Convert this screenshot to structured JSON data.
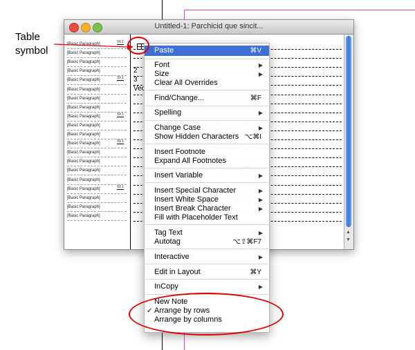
{
  "annotation": {
    "callout_line1": "Table",
    "callout_line2": "symbol",
    "highlight_color": "#e00000"
  },
  "window": {
    "title": "Untitled-1: Parchicid que sincit..."
  },
  "story_editor": {
    "style_rows": [
      {
        "label": "[Basic Paragraph]",
        "num": "59.1"
      },
      {
        "label": "[Basic Paragraph]",
        "num": ""
      },
      {
        "label": "[Basic Paragraph]",
        "num": ""
      },
      {
        "label": "[Basic Paragraph]",
        "num": ""
      },
      {
        "label": "[Basic Paragraph]",
        "num": "59.1"
      },
      {
        "label": "[Basic Paragraph]",
        "num": ""
      },
      {
        "label": "[Basic Paragraph]",
        "num": ""
      },
      {
        "label": "[Basic Paragraph]",
        "num": ""
      },
      {
        "label": "[Basic Paragraph]",
        "num": "59.1"
      },
      {
        "label": "[Basic Paragraph]",
        "num": ""
      },
      {
        "label": "[Basic Paragraph]",
        "num": ""
      },
      {
        "label": "[Basic Paragraph]",
        "num": "59.1"
      },
      {
        "label": "[Basic Paragraph]",
        "num": ""
      },
      {
        "label": "[Basic Paragraph]",
        "num": ""
      },
      {
        "label": "[Basic Paragraph]",
        "num": ""
      },
      {
        "label": "[Basic Paragraph]",
        "num": ""
      },
      {
        "label": "[Basic Paragraph]",
        "num": "59.1"
      },
      {
        "label": "[Basic Paragraph]",
        "num": ""
      },
      {
        "label": "[Basic Paragraph]",
        "num": ""
      },
      {
        "label": "[Basic Paragraph]",
        "num": ""
      }
    ],
    "cells": [
      "2",
      "3",
      "Vec"
    ]
  },
  "context_menu": {
    "paste": {
      "label": "Paste",
      "shortcut": "⌘V"
    },
    "font": "Font",
    "size": "Size",
    "clear_overrides": "Clear All Overrides",
    "find_change": {
      "label": "Find/Change...",
      "shortcut": "⌘F"
    },
    "spelling": "Spelling",
    "change_case": "Change Case",
    "show_hidden": {
      "label": "Show Hidden Characters",
      "shortcut": "⌥⌘I"
    },
    "insert_footnote": "Insert Footnote",
    "expand_footnotes": "Expand All Footnotes",
    "insert_variable": "Insert Variable",
    "insert_special": "Insert Special Character",
    "insert_white": "Insert White Space",
    "insert_break": "Insert Break Character",
    "fill_placeholder": "Fill with Placeholder Text",
    "tag_text": "Tag Text",
    "autotag": {
      "label": "Autotag",
      "shortcut": "⌥⇧⌘F7"
    },
    "interactive": "Interactive",
    "edit_in_layout": {
      "label": "Edit in Layout",
      "shortcut": "⌘Y"
    },
    "incopy": "InCopy",
    "new_note": "New Note",
    "arrange_rows": {
      "label": "Arrange by rows",
      "checked": "✓"
    },
    "arrange_columns": "Arrange by columns"
  }
}
